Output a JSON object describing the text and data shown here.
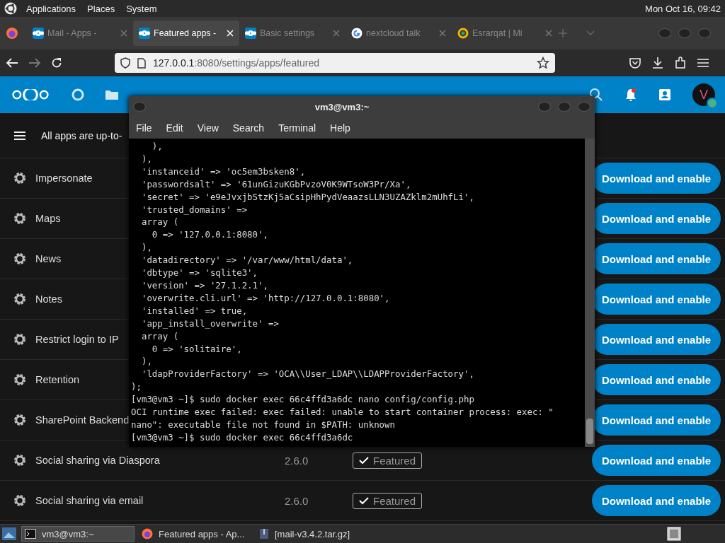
{
  "top_panel": {
    "menus": [
      "Applications",
      "Places",
      "System"
    ],
    "clock": "Mon Oct 16, 09:42"
  },
  "browser": {
    "tabs": [
      {
        "title": "Mail - Apps -",
        "kind": "nextcloud",
        "selected": false
      },
      {
        "title": "Featured apps -",
        "kind": "nextcloud",
        "selected": true
      },
      {
        "title": "Basic settings",
        "kind": "nextcloud",
        "selected": false
      },
      {
        "title": "nextcloud talk",
        "kind": "google",
        "selected": false
      },
      {
        "title": "Esrarqat | Mi",
        "kind": "ring",
        "selected": false
      }
    ],
    "url": {
      "host": "127.0.0.1",
      "rest": ":8080/settings/apps/featured"
    }
  },
  "nextcloud": {
    "avatar": "V",
    "header_text": "All apps are up-to-",
    "apps": [
      {
        "name": "Impersonate",
        "button": "Download and enable"
      },
      {
        "name": "Maps",
        "button": "Download and enable"
      },
      {
        "name": "News",
        "button": "Download and enable"
      },
      {
        "name": "Notes",
        "button": "Download and enable"
      },
      {
        "name": "Restrict login to IP",
        "button": "Download and enable"
      },
      {
        "name": "Retention",
        "button": "Download and enable"
      },
      {
        "name": "SharePoint Backend",
        "button": "Download and enable"
      },
      {
        "name": "Social sharing via Diaspora",
        "version": "2.6.0",
        "badge": "Featured",
        "button": "Download and enable"
      },
      {
        "name": "Social sharing via email",
        "version": "2.6.0",
        "badge": "Featured",
        "button": "Download and enable"
      }
    ]
  },
  "terminal": {
    "title": "vm3@vm3:~",
    "menus": [
      "File",
      "Edit",
      "View",
      "Search",
      "Terminal",
      "Help"
    ],
    "lines": [
      "    ),",
      "  ),",
      "  'instanceid' => 'oc5em3bsken8',",
      "  'passwordsalt' => '61unGizuKGbPvzoV0K9WTsoW3Pr/Xa',",
      "  'secret' => 'e9eJvxjbStzKj5aCsipHhPydVeaazsLLN3UZAZklm2mUhfLi',",
      "  'trusted_domains' =>",
      "  array (",
      "    0 => '127.0.0.1:8080',",
      "  ),",
      "  'datadirectory' => '/var/www/html/data',",
      "  'dbtype' => 'sqlite3',",
      "  'version' => '27.1.2.1',",
      "  'overwrite.cli.url' => 'http://127.0.0.1:8080',",
      "  'installed' => true,",
      "  'app_install_overwrite' =>",
      "  array (",
      "    0 => 'solitaire',",
      "  ),",
      "  'ldapProviderFactory' => 'OCA\\\\User_LDAP\\\\LDAPProviderFactory',",
      ");",
      "[vm3@vm3 ~]$ sudo docker exec 66c4ffd3a6dc nano config/config.php",
      "OCI runtime exec failed: exec failed: unable to start container process: exec: \"",
      "nano\": executable file not found in $PATH: unknown",
      "[vm3@vm3 ~]$ sudo docker exec 66c4ffd3a6dc"
    ]
  },
  "taskbar": {
    "items": [
      {
        "label": "vm3@vm3:~",
        "kind": "terminal",
        "selected": true
      },
      {
        "label": "Featured apps - Ap...",
        "kind": "firefox",
        "selected": false
      },
      {
        "label": "[mail-v3.4.2.tar.gz]",
        "kind": "archive",
        "selected": false
      }
    ]
  }
}
